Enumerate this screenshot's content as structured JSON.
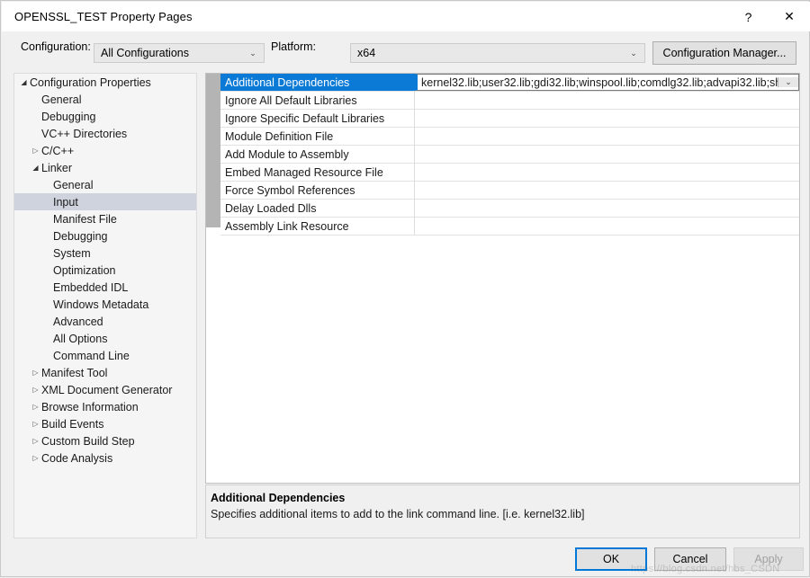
{
  "window": {
    "title": "OPENSSL_TEST Property Pages",
    "help_icon": "question-mark-icon",
    "help_label": "?",
    "close_icon": "close-icon",
    "close_label": "✕"
  },
  "toolbar": {
    "configuration_label": "Configuration:",
    "configuration_value": "All Configurations",
    "platform_label": "Platform:",
    "platform_value": "x64",
    "configuration_manager_label": "Configuration Manager...",
    "chevron_icon": "chevron-down-icon",
    "chevron_glyph": "⌄"
  },
  "tree": {
    "expanded_glyph": "◢",
    "collapsed_glyph": "▷",
    "items": [
      {
        "label": "Configuration Properties",
        "indent": 0,
        "state": "expanded",
        "selected": false
      },
      {
        "label": "General",
        "indent": 1,
        "state": "leaf",
        "selected": false
      },
      {
        "label": "Debugging",
        "indent": 1,
        "state": "leaf",
        "selected": false
      },
      {
        "label": "VC++ Directories",
        "indent": 1,
        "state": "leaf",
        "selected": false
      },
      {
        "label": "C/C++",
        "indent": 1,
        "state": "collapsed",
        "selected": false
      },
      {
        "label": "Linker",
        "indent": 1,
        "state": "expanded",
        "selected": false
      },
      {
        "label": "General",
        "indent": 2,
        "state": "leaf",
        "selected": false
      },
      {
        "label": "Input",
        "indent": 2,
        "state": "leaf",
        "selected": true
      },
      {
        "label": "Manifest File",
        "indent": 2,
        "state": "leaf",
        "selected": false
      },
      {
        "label": "Debugging",
        "indent": 2,
        "state": "leaf",
        "selected": false
      },
      {
        "label": "System",
        "indent": 2,
        "state": "leaf",
        "selected": false
      },
      {
        "label": "Optimization",
        "indent": 2,
        "state": "leaf",
        "selected": false
      },
      {
        "label": "Embedded IDL",
        "indent": 2,
        "state": "leaf",
        "selected": false
      },
      {
        "label": "Windows Metadata",
        "indent": 2,
        "state": "leaf",
        "selected": false
      },
      {
        "label": "Advanced",
        "indent": 2,
        "state": "leaf",
        "selected": false
      },
      {
        "label": "All Options",
        "indent": 2,
        "state": "leaf",
        "selected": false
      },
      {
        "label": "Command Line",
        "indent": 2,
        "state": "leaf",
        "selected": false
      },
      {
        "label": "Manifest Tool",
        "indent": 1,
        "state": "collapsed",
        "selected": false
      },
      {
        "label": "XML Document Generator",
        "indent": 1,
        "state": "collapsed",
        "selected": false
      },
      {
        "label": "Browse Information",
        "indent": 1,
        "state": "collapsed",
        "selected": false
      },
      {
        "label": "Build Events",
        "indent": 1,
        "state": "collapsed",
        "selected": false
      },
      {
        "label": "Custom Build Step",
        "indent": 1,
        "state": "collapsed",
        "selected": false
      },
      {
        "label": "Code Analysis",
        "indent": 1,
        "state": "collapsed",
        "selected": false
      }
    ]
  },
  "grid": {
    "rows": [
      {
        "name": "Additional Dependencies",
        "value": "kernel32.lib;user32.lib;gdi32.lib;winspool.lib;comdlg32.lib;advapi32.lib;sh",
        "selected": true
      },
      {
        "name": "Ignore All Default Libraries",
        "value": "",
        "selected": false
      },
      {
        "name": "Ignore Specific Default Libraries",
        "value": "",
        "selected": false
      },
      {
        "name": "Module Definition File",
        "value": "",
        "selected": false
      },
      {
        "name": "Add Module to Assembly",
        "value": "",
        "selected": false
      },
      {
        "name": "Embed Managed Resource File",
        "value": "",
        "selected": false
      },
      {
        "name": "Force Symbol References",
        "value": "",
        "selected": false
      },
      {
        "name": "Delay Loaded Dlls",
        "value": "",
        "selected": false
      },
      {
        "name": "Assembly Link Resource",
        "value": "",
        "selected": false
      }
    ],
    "value_dropdown_icon": "chevron-down-icon",
    "value_dropdown_glyph": "⌄"
  },
  "description": {
    "title": "Additional Dependencies",
    "body": "Specifies additional items to add to the link command line. [i.e. kernel32.lib]"
  },
  "footer": {
    "ok_label": "OK",
    "cancel_label": "Cancel",
    "apply_label": "Apply"
  },
  "watermark": {
    "text": "https://blog.csdn.net/hbs_CSDN"
  },
  "colors": {
    "accent": "#0a7ad6",
    "default_button_border": "#0078d7",
    "tree_selection": "#cfd3de",
    "gutter": "#b4b4b4",
    "dialog_bg": "#f0f0f0"
  }
}
